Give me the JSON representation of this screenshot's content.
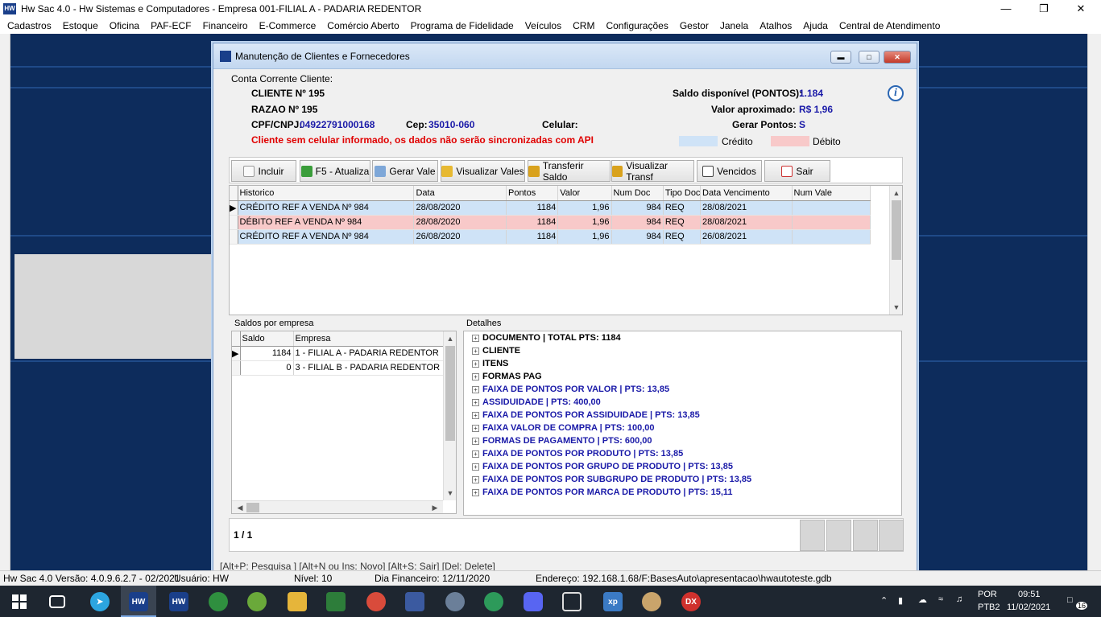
{
  "app": {
    "title": "Hw Sac 4.0 - Hw Sistemas e Computadores - Empresa 001-FILIAL A - PADARIA REDENTOR",
    "icon": "hw-logo-icon"
  },
  "menu": [
    "Cadastros",
    "Estoque",
    "Oficina",
    "PAF-ECF",
    "Financeiro",
    "E-Commerce",
    "Comércio Aberto",
    "Programa de Fidelidade",
    "Veículos",
    "CRM",
    "Configurações",
    "Gestor",
    "Janela",
    "Atalhos",
    "Ajuda",
    "Central de Atendimento"
  ],
  "dialog": {
    "title": "Manutenção de Clientes e Fornecedores"
  },
  "info": {
    "group_label": "Conta Corrente Cliente:",
    "cliente": "CLIENTE Nº 195",
    "razao": "RAZAO Nº 195",
    "cpf_label": "CPF/CNPJ:",
    "cpf_value": "04922791000168",
    "cep_label": "Cep:",
    "cep_value": "35010-060",
    "celular_label": "Celular:",
    "warning": "Cliente sem celular informado, os dados não serão sincronizadas com API",
    "saldo_label": "Saldo disponível (PONTOS):",
    "saldo_value": "1.184",
    "valor_label": "Valor aproximado:",
    "valor_value": "R$ 1,96",
    "gerar_label": "Gerar Pontos:",
    "gerar_value": "S",
    "credito": "Crédito",
    "debito": "Débito",
    "credit_color": "#cfe3f7",
    "debit_color": "#f8c9c9"
  },
  "toolbar": {
    "incluir": "Incluir",
    "atualiza": "F5 - Atualiza",
    "gerar_vale": "Gerar Vale",
    "visualizar_vales": "Visualizar Vales",
    "transferir": "Transferir Saldo",
    "visualizar_transf": "Visualizar Transf",
    "vencidos": "Vencidos",
    "sair": "Sair"
  },
  "main_grid": {
    "headers": [
      "Historico",
      "Data",
      "Pontos",
      "Valor",
      "Num Doc",
      "Tipo Doc",
      "Data Vencimento",
      "Num Vale"
    ],
    "rows": [
      {
        "type": "credito",
        "historico": "CRÉDITO REF A VENDA Nº 984",
        "data": "28/08/2020",
        "pontos": "1184",
        "valor": "1,96",
        "num_doc": "984",
        "tipo_doc": "REQ",
        "vencimento": "28/08/2021",
        "num_vale": ""
      },
      {
        "type": "debito",
        "historico": "DÉBITO REF A VENDA Nº 984",
        "data": "28/08/2020",
        "pontos": "1184",
        "valor": "1,96",
        "num_doc": "984",
        "tipo_doc": "REQ",
        "vencimento": "28/08/2021",
        "num_vale": ""
      },
      {
        "type": "credito",
        "historico": "CRÉDITO REF A VENDA Nº 984",
        "data": "26/08/2020",
        "pontos": "1184",
        "valor": "1,96",
        "num_doc": "984",
        "tipo_doc": "REQ",
        "vencimento": "26/08/2021",
        "num_vale": ""
      }
    ]
  },
  "saldos": {
    "group_label": "Saldos por empresa",
    "headers": [
      "Saldo",
      "Empresa"
    ],
    "rows": [
      {
        "saldo": "1184",
        "empresa": "1 - FILIAL A - PADARIA REDENTOR"
      },
      {
        "saldo": "0",
        "empresa": "3 - FILIAL B - PADARIA REDENTOR"
      }
    ]
  },
  "detalhes": {
    "group_label": "Detalhes",
    "items": [
      {
        "text": "DOCUMENTO | TOTAL PTS: 1184",
        "color": "#000000"
      },
      {
        "text": "CLIENTE",
        "color": "#000000"
      },
      {
        "text": "ITENS",
        "color": "#000000"
      },
      {
        "text": "FORMAS PAG",
        "color": "#000000"
      },
      {
        "text": "FAIXA DE PONTOS POR VALOR | PTS: 13,85",
        "color": "#1a1aa8"
      },
      {
        "text": "ASSIDUIDADE | PTS: 400,00",
        "color": "#1a1aa8"
      },
      {
        "text": "FAIXA DE PONTOS POR ASSIDUIDADE | PTS: 13,85",
        "color": "#1a1aa8"
      },
      {
        "text": "FAIXA VALOR DE COMPRA | PTS: 100,00",
        "color": "#1a1aa8"
      },
      {
        "text": "FORMAS DE PAGAMENTO | PTS: 600,00",
        "color": "#1a1aa8"
      },
      {
        "text": "FAIXA DE PONTOS POR PRODUTO | PTS: 13,85",
        "color": "#1a1aa8"
      },
      {
        "text": "FAIXA DE PONTOS POR GRUPO DE PRODUTO | PTS: 13,85",
        "color": "#1a1aa8"
      },
      {
        "text": "FAIXA DE PONTOS POR SUBGRUPO DE PRODUTO | PTS: 13,85",
        "color": "#1a1aa8"
      },
      {
        "text": "FAIXA DE PONTOS POR MARCA DE PRODUTO | PTS: 15,11",
        "color": "#1a1aa8"
      }
    ]
  },
  "pager": "1 / 1",
  "hints": "[Alt+P: Pesquisa ]   [Alt+N ou Ins: Novo]   [Alt+S: Sair]   [Del: Delete]",
  "status": {
    "version": "Hw Sac 4.0 Versão: 4.0.9.6.2.7 - 02/2021",
    "user": "Usuário: HW",
    "level": "Nível: 10",
    "fin_day": "Dia Financeiro: 12/11/2020",
    "address": "Endereço: 192.168.1.68/F:BasesAuto\\apresentacao\\hwautoteste.gdb"
  },
  "tray": {
    "lang1": "POR",
    "lang2": "PTB2",
    "time": "09:51",
    "date": "11/02/2021",
    "notif": "16"
  }
}
